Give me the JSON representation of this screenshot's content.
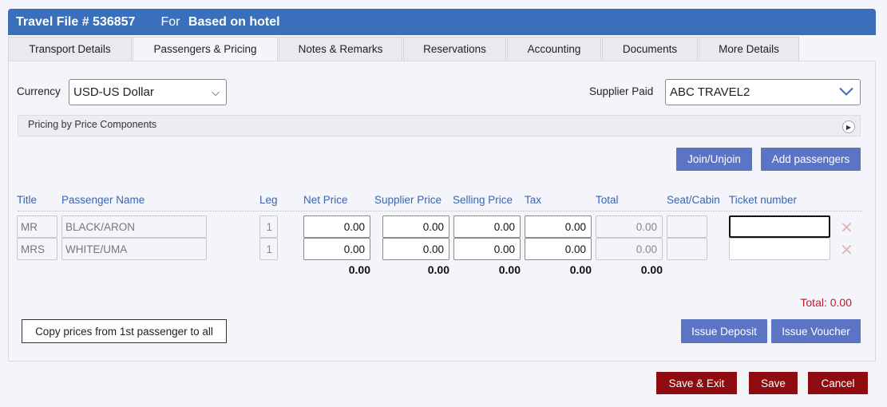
{
  "header": {
    "title": "Travel File  # 536857",
    "for_label": "For",
    "for_value": "Based on hotel"
  },
  "tabs": [
    {
      "label": "Transport Details"
    },
    {
      "label": "Passengers & Pricing",
      "active": true
    },
    {
      "label": "Notes & Remarks"
    },
    {
      "label": "Reservations"
    },
    {
      "label": "Accounting"
    },
    {
      "label": "Documents"
    },
    {
      "label": "More Details"
    }
  ],
  "currency": {
    "label": "Currency",
    "value": "USD-US Dollar"
  },
  "supplier_paid": {
    "label": "Supplier Paid",
    "value": "ABC TRAVEL2"
  },
  "pricing_bar": {
    "label": "Pricing by Price Components"
  },
  "actions": {
    "join": "Join/Unjoin",
    "add_passengers": "Add passengers"
  },
  "table": {
    "headers": [
      "Title",
      "Passenger Name",
      "Leg",
      "Net Price",
      "Supplier Price",
      "Selling Price",
      "Tax",
      "Total",
      "Seat/Cabin",
      "Ticket number"
    ],
    "rows": [
      {
        "title": "MR",
        "name": "BLACK/ARON",
        "leg": "1",
        "net": "0.00",
        "supplier": "0.00",
        "selling": "0.00",
        "tax": "0.00",
        "total": "0.00",
        "seat": "",
        "ticket": ""
      },
      {
        "title": "MRS",
        "name": "WHITE/UMA",
        "leg": "1",
        "net": "0.00",
        "supplier": "0.00",
        "selling": "0.00",
        "tax": "0.00",
        "total": "0.00",
        "seat": "",
        "ticket": ""
      }
    ],
    "totals": {
      "net": "0.00",
      "supplier": "0.00",
      "selling": "0.00",
      "tax": "0.00",
      "total": "0.00"
    },
    "grand_total": "Total: 0.00"
  },
  "copy_button": "Copy prices from 1st passenger to all",
  "issue": {
    "deposit": "Issue Deposit",
    "voucher": "Issue Voucher"
  },
  "footer": {
    "save_exit": "Save & Exit",
    "save": "Save",
    "cancel": "Cancel"
  },
  "colors": {
    "header": "#3a6fbc",
    "button_blue": "#5c74c4",
    "button_red": "#8e0c0f",
    "total_red": "#c0182a"
  }
}
